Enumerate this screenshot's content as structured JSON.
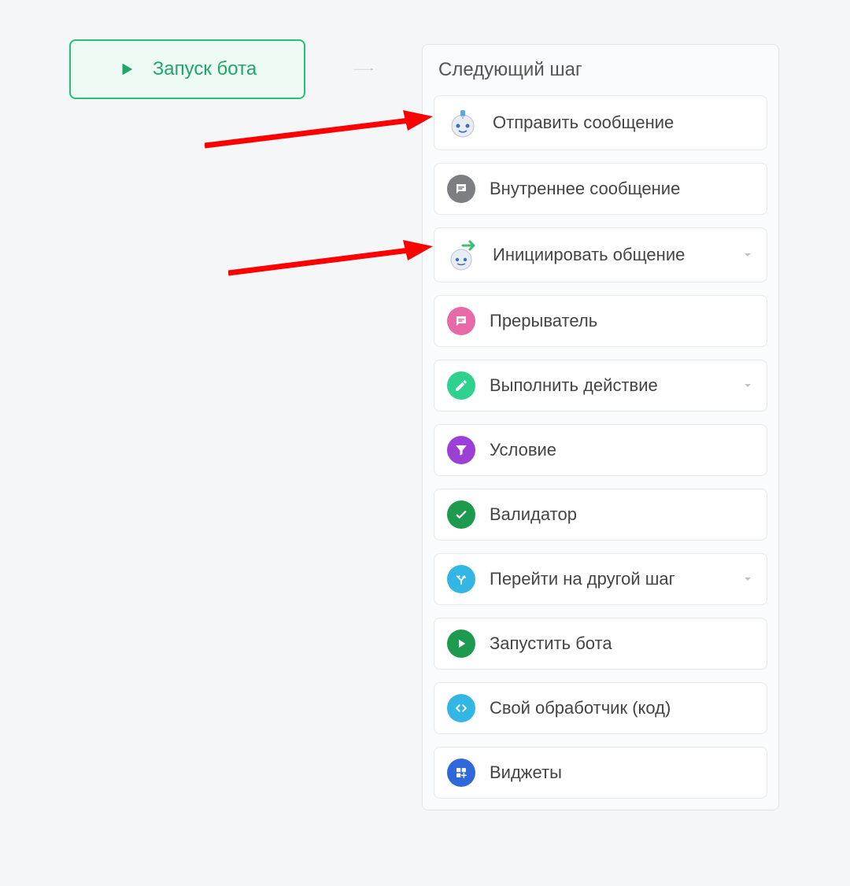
{
  "start_node": {
    "label": "Запуск бота"
  },
  "panel": {
    "title": "Следующий шаг",
    "options": [
      {
        "id": "send-message",
        "label": "Отправить сообщение",
        "icon": "robot",
        "has_chevron": false
      },
      {
        "id": "internal-message",
        "label": "Внутреннее сообщение",
        "icon": "chat-grey",
        "has_chevron": false
      },
      {
        "id": "initiate",
        "label": "Инициировать общение",
        "icon": "robot-green",
        "has_chevron": true
      },
      {
        "id": "interrupter",
        "label": "Прерыватель",
        "icon": "chat-pink",
        "has_chevron": false
      },
      {
        "id": "do-action",
        "label": "Выполнить действие",
        "icon": "pencil-green",
        "has_chevron": true
      },
      {
        "id": "condition",
        "label": "Условие",
        "icon": "funnel-purple",
        "has_chevron": false
      },
      {
        "id": "validator",
        "label": "Валидатор",
        "icon": "check-darkgreen",
        "has_chevron": false
      },
      {
        "id": "goto-step",
        "label": "Перейти на другой шаг",
        "icon": "branch-cyan",
        "has_chevron": true
      },
      {
        "id": "run-bot",
        "label": "Запустить бота",
        "icon": "play-green",
        "has_chevron": false
      },
      {
        "id": "custom-handler",
        "label": "Свой обработчик (код)",
        "icon": "code-cyan",
        "has_chevron": false
      },
      {
        "id": "widgets",
        "label": "Виджеты",
        "icon": "widgets-blue",
        "has_chevron": false
      }
    ]
  },
  "colors": {
    "grey": "#7d7e82",
    "pink": "#e66aa8",
    "green": "#2fd18f",
    "darkgreen": "#1e9a4e",
    "purple": "#9b3fd6",
    "cyan": "#34b6e4",
    "blue": "#2e68d9"
  }
}
